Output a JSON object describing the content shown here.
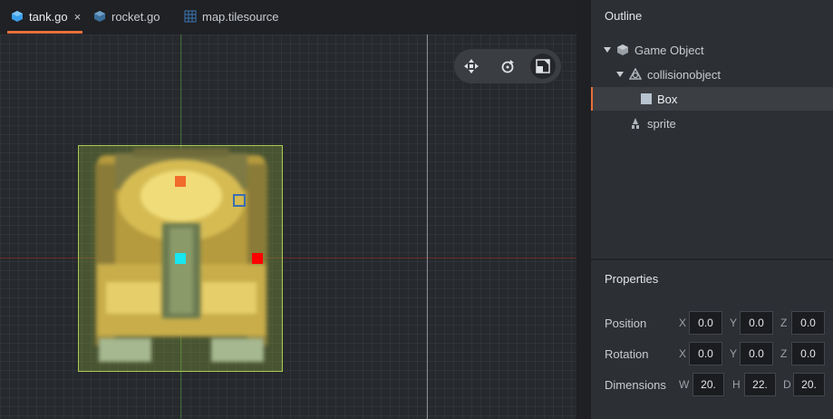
{
  "tabs": [
    {
      "label": "tank.go",
      "icon": "cube-icon",
      "active": true,
      "closable": true
    },
    {
      "label": "rocket.go",
      "icon": "cube-icon",
      "active": false
    },
    {
      "label": "map.tilesource",
      "icon": "grid-icon",
      "active": false
    }
  ],
  "tab_close_glyph": "×",
  "toolbar": {
    "tools": [
      {
        "name": "move-tool",
        "icon": "move-arrows-icon"
      },
      {
        "name": "rotate-tool",
        "icon": "rotate-icon"
      },
      {
        "name": "scale-tool",
        "icon": "scale-icon",
        "selected": true
      }
    ]
  },
  "outline": {
    "title": "Outline",
    "items": [
      {
        "label": "Game Object",
        "icon": "cube-icon",
        "expanded": true
      },
      {
        "label": "collisionobject",
        "icon": "collision-icon",
        "expanded": true
      },
      {
        "label": "Box",
        "icon": "box-icon",
        "selected": true
      },
      {
        "label": "sprite",
        "icon": "sprite-icon"
      }
    ]
  },
  "properties": {
    "title": "Properties",
    "position": {
      "label": "Position",
      "x_label": "X",
      "x": "0.0",
      "y_label": "Y",
      "y": "0.0",
      "z_label": "Z",
      "z": "0.0"
    },
    "rotation": {
      "label": "Rotation",
      "x_label": "X",
      "x": "0.0",
      "y_label": "Y",
      "y": "0.0",
      "z_label": "Z",
      "z": "0.0"
    },
    "dimensions": {
      "label": "Dimensions",
      "w_label": "W",
      "w": "20.",
      "h_label": "H",
      "h": "22.",
      "d_label": "D",
      "d": "20."
    }
  },
  "colors": {
    "accent": "#e8703a",
    "selection_fill": "#8caa3c",
    "handle_orange": "#f26b2a",
    "handle_cyan": "#18e6f0",
    "handle_red": "#ff0000",
    "handle_blue": "#3a6fb0"
  }
}
